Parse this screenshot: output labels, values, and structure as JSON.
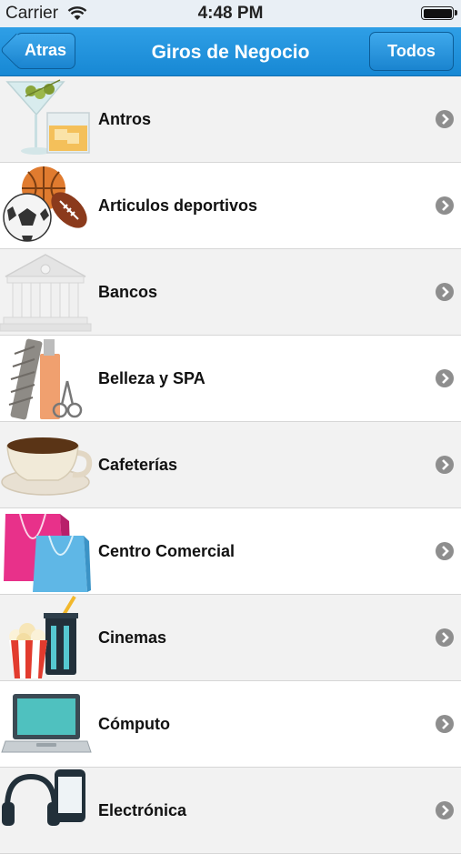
{
  "status_bar": {
    "carrier": "Carrier",
    "time": "4:48 PM"
  },
  "nav": {
    "back_label": "Atras",
    "title": "Giros de Negocio",
    "all_label": "Todos"
  },
  "categories": [
    {
      "label": "Antros",
      "icon": "cocktail-glasses-icon"
    },
    {
      "label": "Articulos deportivos",
      "icon": "sports-balls-icon"
    },
    {
      "label": "Bancos",
      "icon": "bank-building-icon"
    },
    {
      "label": "Belleza y SPA",
      "icon": "beauty-tools-icon"
    },
    {
      "label": "Cafeterías",
      "icon": "coffee-cup-icon"
    },
    {
      "label": "Centro Comercial",
      "icon": "shopping-bags-icon"
    },
    {
      "label": "Cinemas",
      "icon": "popcorn-drink-icon"
    },
    {
      "label": "Cómputo",
      "icon": "laptop-icon"
    },
    {
      "label": "Electrónica",
      "icon": "headphones-phone-icon"
    }
  ],
  "colors": {
    "nav_bar": "#1f93dc",
    "row_alt": "#f2f2f2",
    "chevron": "#8e8e8e"
  }
}
